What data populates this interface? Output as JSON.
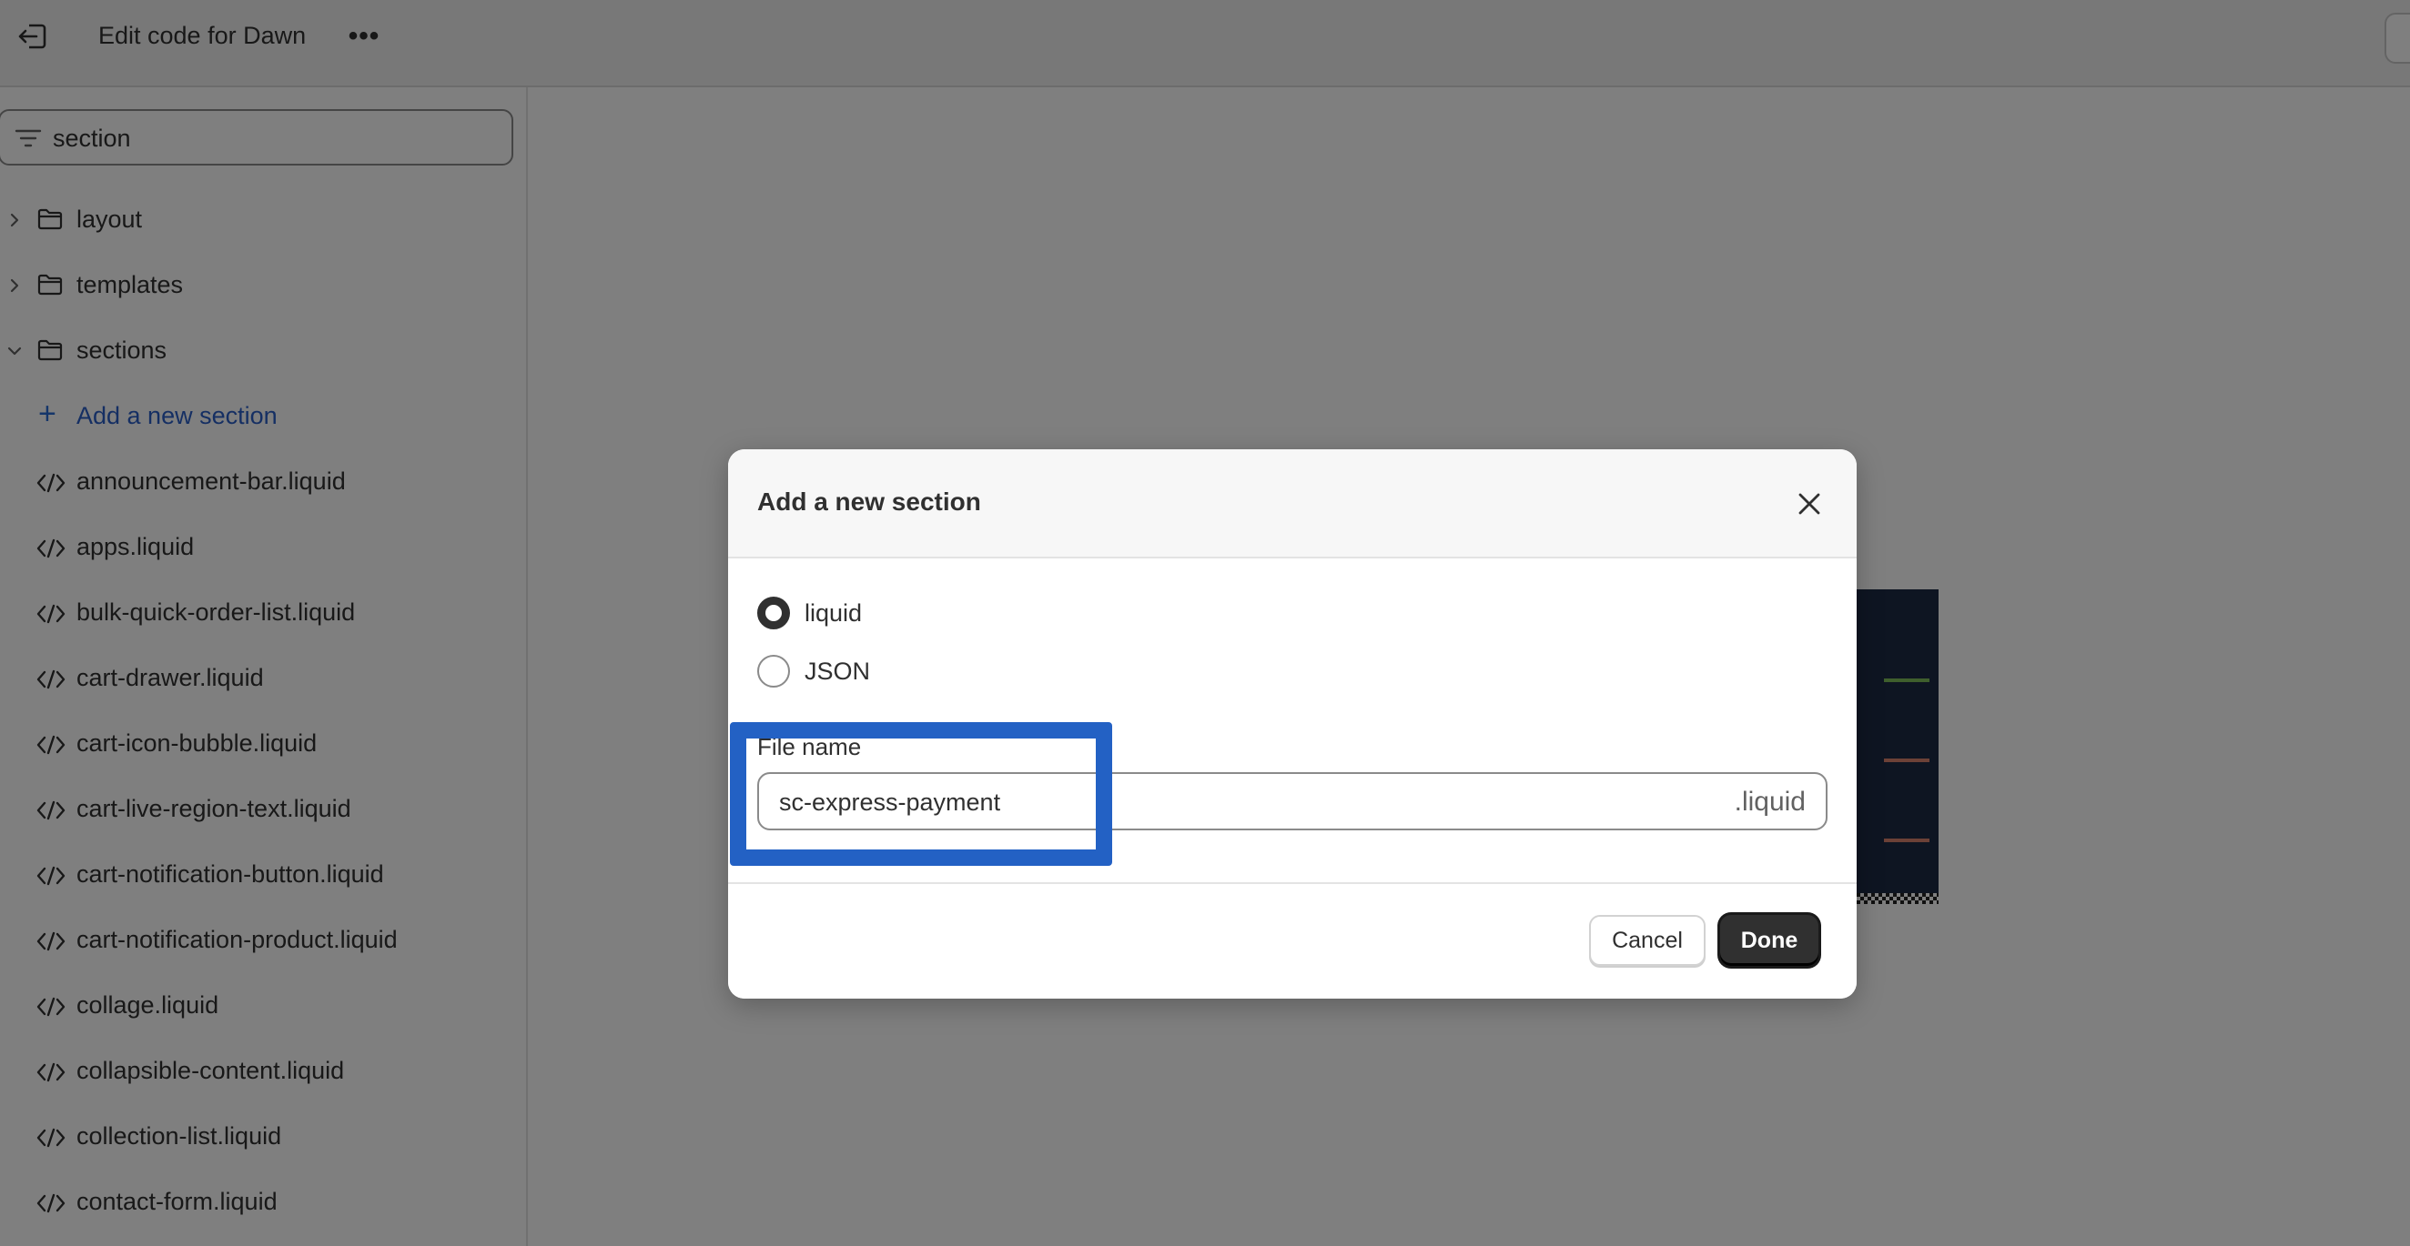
{
  "topbar": {
    "title": "Edit code for Dawn",
    "more_label": "•••"
  },
  "sidebar": {
    "filter_value": "section",
    "folders": [
      {
        "label": "layout",
        "expanded": false
      },
      {
        "label": "templates",
        "expanded": false
      },
      {
        "label": "sections",
        "expanded": true
      }
    ],
    "add_label": "Add a new section",
    "files": [
      "announcement-bar.liquid",
      "apps.liquid",
      "bulk-quick-order-list.liquid",
      "cart-drawer.liquid",
      "cart-icon-bubble.liquid",
      "cart-live-region-text.liquid",
      "cart-notification-button.liquid",
      "cart-notification-product.liquid",
      "collage.liquid",
      "collapsible-content.liquid",
      "collection-list.liquid",
      "contact-form.liquid"
    ]
  },
  "modal": {
    "title": "Add a new section",
    "options": [
      {
        "label": "liquid",
        "checked": true
      },
      {
        "label": "JSON",
        "checked": false
      }
    ],
    "field_label": "File name",
    "file_value": "sc-express-payment",
    "suffix": ".liquid",
    "cancel_label": "Cancel",
    "done_label": "Done"
  },
  "colors": {
    "accent_link": "#2a5ec7",
    "highlight": "#2361c4",
    "primary_button": "#303030"
  }
}
